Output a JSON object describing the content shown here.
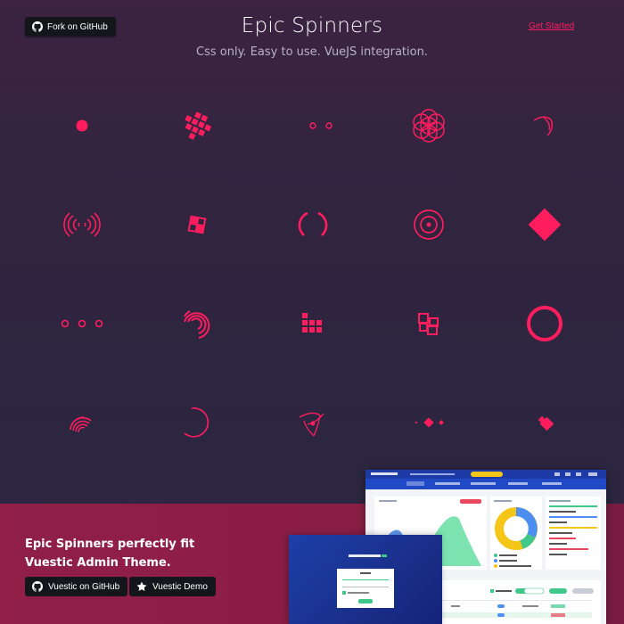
{
  "header": {
    "fork_label": "Fork on GitHub",
    "title": "Epic Spinners",
    "subtitle": "Css only. Easy to use. VueJS integration.",
    "get_started": "Get Started"
  },
  "colors": {
    "accent": "#ff1d5e",
    "background_top": "#3b2341",
    "background_bottom": "#2c2640",
    "promo_band": "#8e1f46"
  },
  "spinners": [
    {
      "name": "flower-spinner"
    },
    {
      "name": "pixel-spinner"
    },
    {
      "name": "hollow-dots-spinner"
    },
    {
      "name": "intersecting-circles-spinner"
    },
    {
      "name": "orbit-spinner"
    },
    {
      "name": "radar-spinner"
    },
    {
      "name": "scaling-squares-spinner"
    },
    {
      "name": "half-circle-spinner"
    },
    {
      "name": "trinity-rings-spinner"
    },
    {
      "name": "fulfilling-square-spinner"
    },
    {
      "name": "circles-to-rhombuses-spinner"
    },
    {
      "name": "semipolar-spinner"
    },
    {
      "name": "self-building-square-spinner"
    },
    {
      "name": "swapping-squares-spinner"
    },
    {
      "name": "fulfilling-bouncing-circle-spinner"
    },
    {
      "name": "fingerprint-spinner"
    },
    {
      "name": "spring-spinner"
    },
    {
      "name": "atom-spinner"
    },
    {
      "name": "looping-rhombuses-spinner"
    },
    {
      "name": "breeding-rhombus-spinner"
    }
  ],
  "promo": {
    "line1": "Epic Spinners perfectly fit",
    "line2": "Vuestic Admin Theme.",
    "github_label": "Vuestic on GitHub",
    "demo_label": "Vuestic Demo"
  }
}
